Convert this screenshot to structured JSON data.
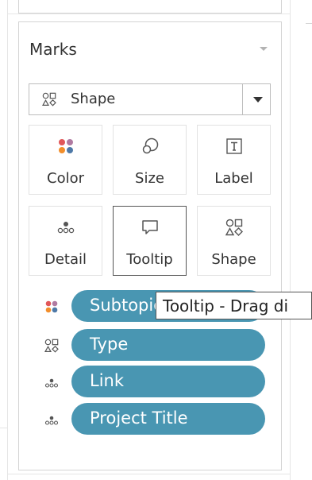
{
  "marks_card": {
    "title": "Marks",
    "mark_type": {
      "selected": "Shape",
      "icon": "shape-icon"
    },
    "buttons": [
      {
        "label": "Color",
        "icon": "color-icon",
        "selected": false
      },
      {
        "label": "Size",
        "icon": "size-icon",
        "selected": false
      },
      {
        "label": "Label",
        "icon": "label-icon",
        "selected": false
      },
      {
        "label": "Detail",
        "icon": "detail-icon",
        "selected": false
      },
      {
        "label": "Tooltip",
        "icon": "tooltip-icon",
        "selected": true
      },
      {
        "label": "Shape",
        "icon": "shape-icon",
        "selected": false
      }
    ],
    "fields": [
      {
        "name": "Subtopic",
        "encoding_icon": "color-icon"
      },
      {
        "name": "Type",
        "encoding_icon": "shape-icon"
      },
      {
        "name": "Link",
        "encoding_icon": "detail-icon"
      },
      {
        "name": "Project Title",
        "encoding_icon": "detail-icon"
      }
    ]
  },
  "tooltip_popup": {
    "text": "Tooltip - Drag di"
  },
  "colors": {
    "pill": "#4996b2",
    "color_dots": [
      "#e15759",
      "#b07aa1",
      "#f28e2b",
      "#4e79a7"
    ]
  }
}
